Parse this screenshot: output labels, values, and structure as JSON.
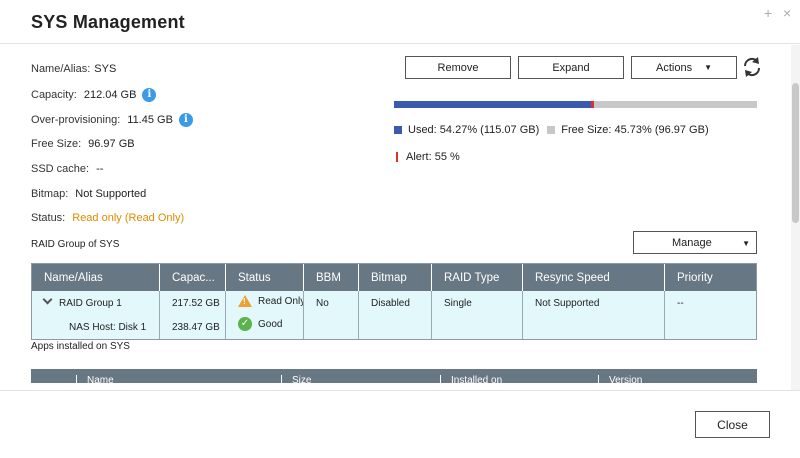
{
  "window": {
    "title": "SYS  Management",
    "plus_glyph": "+",
    "close_glyph": "×"
  },
  "info": {
    "name": {
      "label": "Name/Alias:",
      "value": "SYS"
    },
    "capacity": {
      "label": "Capacity:",
      "value": "212.04 GB"
    },
    "overprov": {
      "label": "Over-provisioning:",
      "value": "11.45 GB"
    },
    "free": {
      "label": "Free Size:",
      "value": "96.97 GB"
    },
    "ssd": {
      "label": "SSD cache:",
      "value": "--"
    },
    "bitmap": {
      "label": "Bitmap:",
      "value": "Not Supported"
    },
    "status": {
      "label": "Status:",
      "value": "Read only (Read Only)"
    }
  },
  "toolbar": {
    "remove": "Remove",
    "expand": "Expand",
    "actions": "Actions"
  },
  "usage": {
    "used_fraction": 0.5427,
    "alert_fraction": 0.55,
    "used_text": "Used: 54.27% (115.07 GB)",
    "free_text": "Free Size: 45.73% (96.97 GB)",
    "alert_text": "Alert: 55 %",
    "colors": {
      "used": "#3a5bad",
      "free": "#c8c8c8",
      "alert": "#e0302d"
    }
  },
  "raid": {
    "section_title": "RAID Group of SYS",
    "manage_label": "Manage",
    "columns": [
      "Name/Alias",
      "Capac...",
      "Status",
      "BBM",
      "Bitmap",
      "RAID Type",
      "Resync Speed",
      "Priority"
    ],
    "row": {
      "name": "RAID Group 1",
      "name_sub": "NAS Host: Disk 1",
      "capacity": "217.52 GB",
      "capacity_sub": "238.47 GB",
      "status": "Read Only",
      "status_sub": "Good",
      "bbm": "No",
      "bitmap": "Disabled",
      "raid_type": "Single",
      "resync": "Not Supported",
      "priority": "--"
    }
  },
  "apps": {
    "section_title": "Apps installed on SYS",
    "columns": [
      "Name",
      "Size",
      "Installed on",
      "Version"
    ]
  },
  "footer": {
    "close_label": "Close"
  }
}
